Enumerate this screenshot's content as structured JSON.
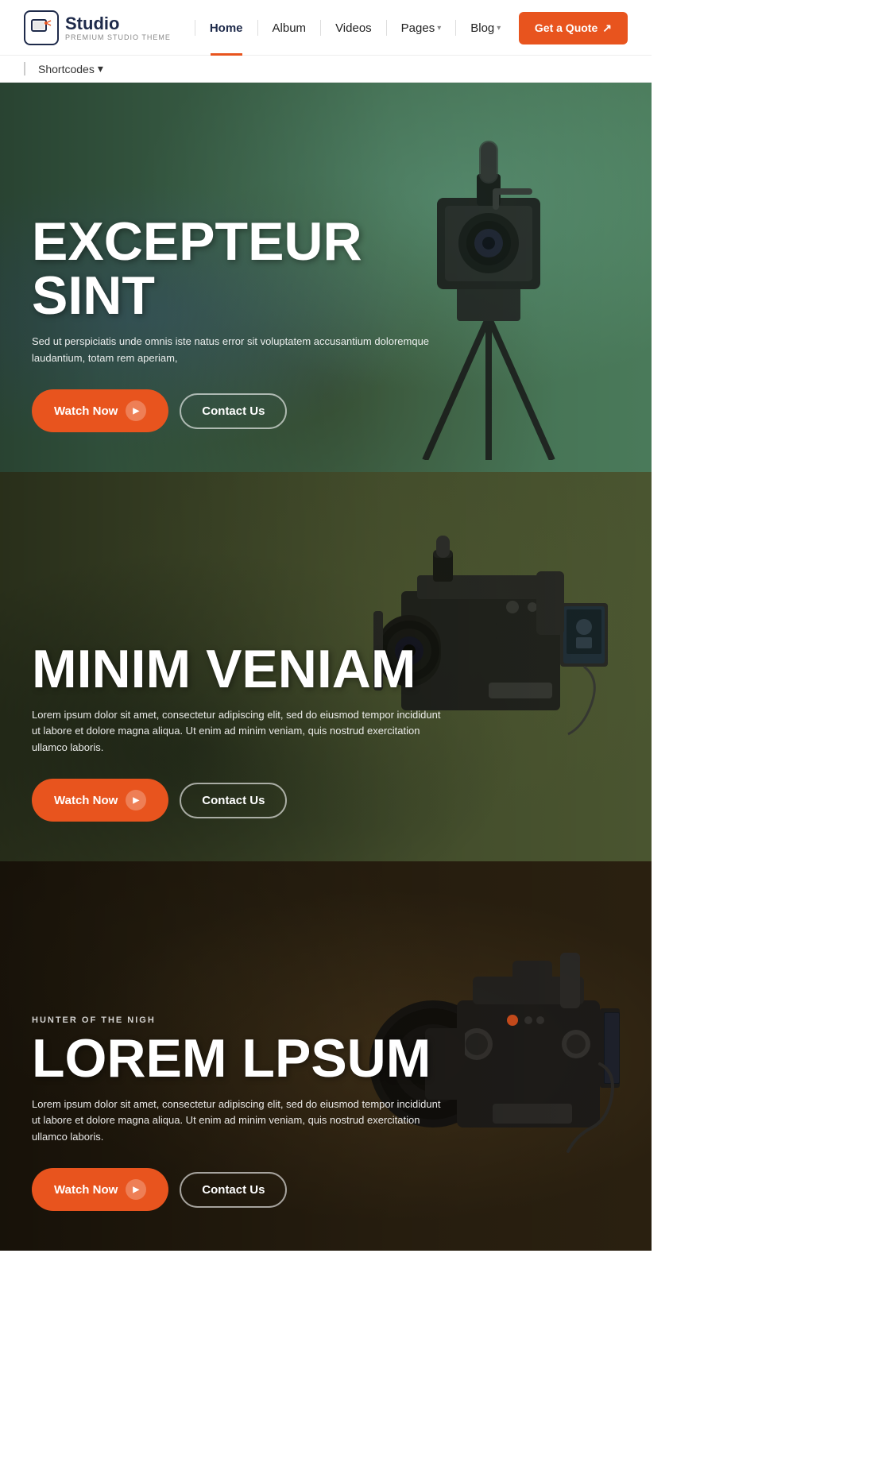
{
  "brand": {
    "name": "Studio",
    "tagline": "PREMIUM STUDIO THEME",
    "icon": "film-icon"
  },
  "nav": {
    "items": [
      {
        "label": "Home",
        "active": true,
        "hasDropdown": false
      },
      {
        "label": "Album",
        "active": false,
        "hasDropdown": false
      },
      {
        "label": "Videos",
        "active": false,
        "hasDropdown": false
      },
      {
        "label": "Pages",
        "active": false,
        "hasDropdown": true
      },
      {
        "label": "Blog",
        "active": false,
        "hasDropdown": true
      }
    ],
    "cta": {
      "label": "Get a Quote",
      "icon": "external-link-icon"
    }
  },
  "shortcodes": {
    "label": "Shortcodes",
    "hasDropdown": true
  },
  "heroes": [
    {
      "title": "EXCEPTEUR SINT",
      "subtitle": "Sed ut perspiciatis unde omnis iste natus error sit voluptatem accusantium doloremque laudantium, totam rem aperiam,",
      "label": null,
      "watch_label": "Watch Now",
      "contact_label": "Contact Us",
      "theme": "outdoor"
    },
    {
      "title": "MINIM VENIAM",
      "subtitle": "Lorem ipsum dolor sit amet, consectetur adipiscing elit, sed do eiusmod tempor incididunt ut labore et dolore magna aliqua. Ut enim ad minim veniam, quis nostrud exercitation ullamco laboris.",
      "label": null,
      "watch_label": "Watch Now",
      "contact_label": "Contact Us",
      "theme": "dark-olive"
    },
    {
      "title": "LOREM LPSUM",
      "subtitle": "HUNTER OF THE NIGH Lorem ipsum dolor sit amet, consectetur adipiscing elit, sed do eiusmod tempor incididunt ut labore et dolore magna aliqua. Ut enim ad minim veniam, quis nostrud exercitation ullamco laboris.",
      "label": "HUNTER OF THE NIGH",
      "watch_label": "Watch Now",
      "contact_label": "Contact Us",
      "theme": "dark-studio"
    }
  ],
  "colors": {
    "accent": "#e8541e",
    "dark": "#1e2a4a",
    "white": "#ffffff"
  }
}
